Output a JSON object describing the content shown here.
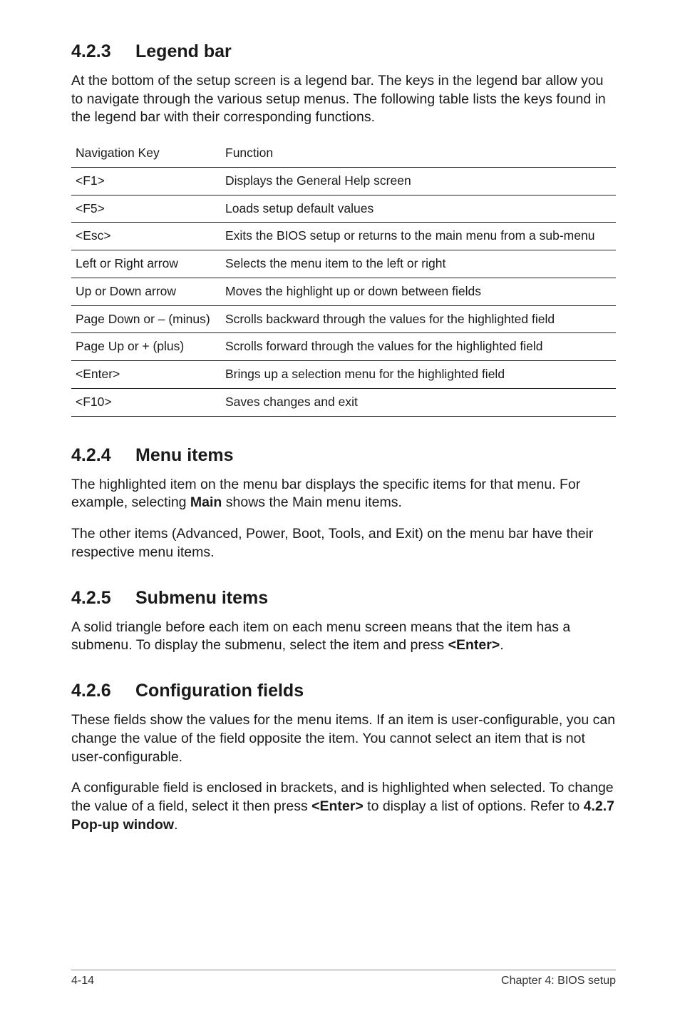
{
  "sec1": {
    "num": "4.2.3",
    "title": "Legend bar",
    "intro": "At the bottom of the setup screen is a legend bar. The keys in the legend bar allow you to navigate through the various setup menus. The following table lists the keys found in the legend bar with their corresponding functions.",
    "headers": {
      "col1": "Navigation Key",
      "col2": "Function"
    },
    "rows": [
      {
        "key": "<F1>",
        "fn": "Displays the General Help screen"
      },
      {
        "key": "<F5>",
        "fn": "Loads setup default values"
      },
      {
        "key": "<Esc>",
        "fn": "Exits the BIOS setup or returns to the main menu from a sub-menu"
      },
      {
        "key": "Left or Right arrow",
        "fn": "Selects the menu item to the left or right"
      },
      {
        "key": "Up or Down arrow",
        "fn": "Moves the highlight up or down between fields"
      },
      {
        "key": "Page Down or – (minus)",
        "fn": "Scrolls backward through the values for the highlighted field"
      },
      {
        "key": "Page Up or + (plus)",
        "fn": "Scrolls forward through the values for the highlighted field"
      },
      {
        "key": "<Enter>",
        "fn": "Brings up a selection menu for the highlighted field"
      },
      {
        "key": "<F10>",
        "fn": "Saves changes and exit"
      }
    ]
  },
  "sec2": {
    "num": "4.2.4",
    "title": "Menu items",
    "p1a": "The highlighted item on the menu bar displays the specific items for that menu. For example, selecting ",
    "p1b": "Main",
    "p1c": " shows the Main menu items.",
    "p2": "The other items (Advanced, Power, Boot, Tools, and Exit) on the menu bar have their respective menu items."
  },
  "sec3": {
    "num": "4.2.5",
    "title": "Submenu items",
    "p1a": "A solid triangle before each item on each menu screen means that the item has a submenu. To display the submenu, select the item and press ",
    "p1b": "<Enter>",
    "p1c": "."
  },
  "sec4": {
    "num": "4.2.6",
    "title": "Configuration fields",
    "p1": "These fields show the values for the menu items. If an item is user-configurable, you can change the value of the field opposite the item. You cannot select an item that is not user-configurable.",
    "p2a": "A configurable field is enclosed in brackets, and is highlighted when selected. To change the value of a field, select it then press ",
    "p2b": "<Enter>",
    "p2c": " to display a list of options. Refer to ",
    "p2d": "4.2.7 Pop-up window",
    "p2e": "."
  },
  "footer": {
    "left": "4-14",
    "right": "Chapter 4: BIOS setup"
  }
}
